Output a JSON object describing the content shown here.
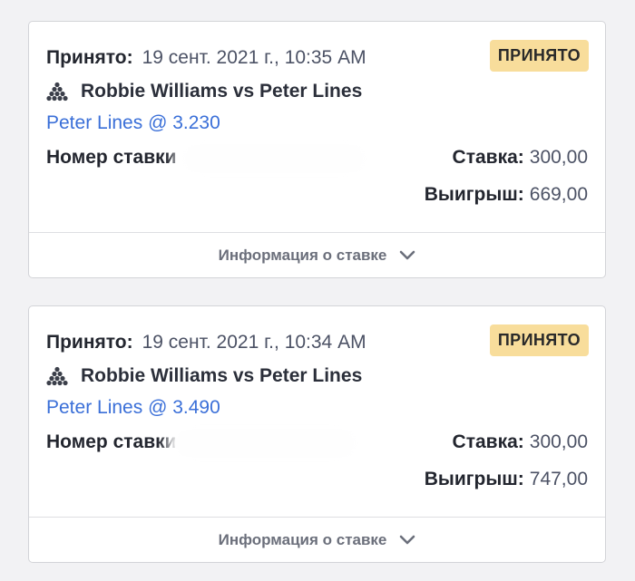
{
  "bets": [
    {
      "accepted_label": "Принято:",
      "accepted_date": "19 сент. 2021 г., 10:35 AM",
      "status": "ПРИНЯТО",
      "event": "Robbie Williams vs Peter Lines",
      "pick": "Peter Lines @ 3.230",
      "bet_number_label": "Номер ставки",
      "stake_label": "Ставка:",
      "stake_value": "300,00",
      "win_label": "Выигрыш:",
      "win_value": "669,00",
      "details_label": "Информация о ставке"
    },
    {
      "accepted_label": "Принято:",
      "accepted_date": "19 сент. 2021 г., 10:34 AM",
      "status": "ПРИНЯТО",
      "event": "Robbie Williams vs Peter Lines",
      "pick": "Peter Lines @ 3.490",
      "bet_number_label": "Номер ставки",
      "stake_label": "Ставка:",
      "stake_value": "300,00",
      "win_label": "Выигрыш:",
      "win_value": "747,00",
      "details_label": "Информация о ставке"
    }
  ],
  "icons": {
    "sport": "snooker-balls-icon",
    "expand": "chevron-down-icon"
  },
  "colors": {
    "badge_bg": "#f8dd9b",
    "link": "#3a6fd8",
    "background": "#f2f2f4"
  }
}
